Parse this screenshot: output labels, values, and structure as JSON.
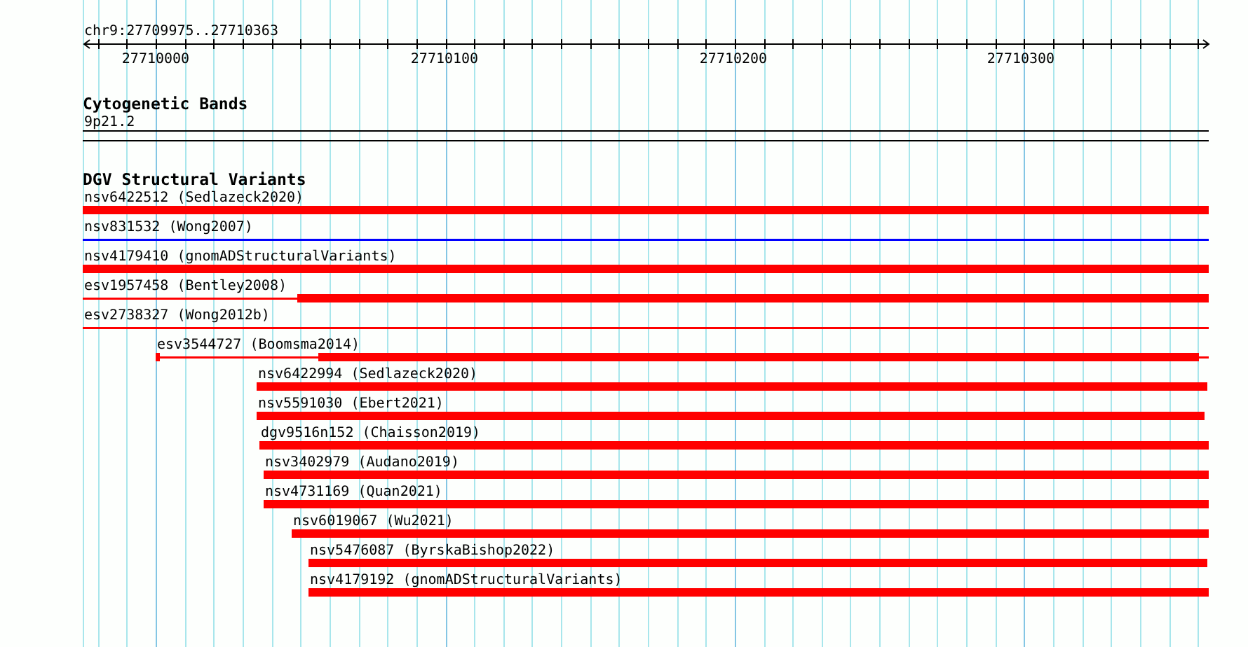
{
  "ruler": {
    "location": "chr9:27709975..27710363",
    "ticks": [
      "27710000",
      "27710100",
      "27710200",
      "27710300"
    ]
  },
  "tracks": [
    {
      "title": "Cytogenetic Bands",
      "kind": "bands",
      "features": [
        {
          "label": "9p21.2"
        }
      ]
    },
    {
      "title": "DGV Structural Variants",
      "kind": "variants",
      "features": [
        {
          "label": "nsv6422512 (Sedlazeck2020)",
          "kind": "bar",
          "color": "#ff0000"
        },
        {
          "label": "nsv831532 (Wong2007)",
          "kind": "line",
          "color": "#0000ff"
        },
        {
          "label": "nsv4179410 (gnomADStructuralVariants)",
          "kind": "bar",
          "color": "#ff0000"
        },
        {
          "label": "esv1957458 (Bentley2008)",
          "kind": "split",
          "color": "#ff0000"
        },
        {
          "label": "esv2738327 (Wong2012b)",
          "kind": "line",
          "color": "#ff0000"
        },
        {
          "label": "esv3544727 (Boomsma2014)",
          "kind": "split",
          "color": "#ff0000"
        },
        {
          "label": "nsv6422994 (Sedlazeck2020)",
          "kind": "bar",
          "color": "#ff0000"
        },
        {
          "label": "nsv5591030 (Ebert2021)",
          "kind": "bar",
          "color": "#ff0000"
        },
        {
          "label": "dgv9516n152 (Chaisson2019)",
          "kind": "bar",
          "color": "#ff0000"
        },
        {
          "label": "nsv3402979 (Audano2019)",
          "kind": "bar",
          "color": "#ff0000"
        },
        {
          "label": "nsv4731169 (Quan2021)",
          "kind": "bar",
          "color": "#ff0000"
        },
        {
          "label": "nsv6019067 (Wu2021)",
          "kind": "bar",
          "color": "#ff0000"
        },
        {
          "label": "nsv5476087 (ByrskaBishop2022)",
          "kind": "bar",
          "color": "#ff0000"
        },
        {
          "label": "nsv4179192 (gnomADStructuralVariants)",
          "kind": "bar",
          "color": "#ff0000"
        }
      ]
    }
  ]
}
